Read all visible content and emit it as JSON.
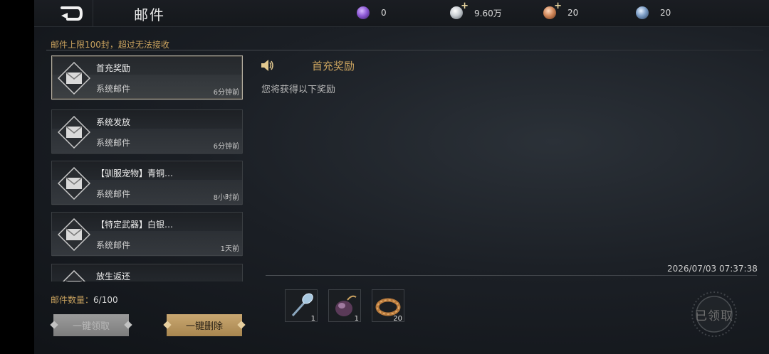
{
  "header": {
    "title": "邮件",
    "back_icon": "back-arrow-icon",
    "currencies": [
      {
        "name": "purple-gem",
        "value": "0",
        "color": "#8e5ad6",
        "has_plus": false
      },
      {
        "name": "silver-coin",
        "value": "9.60万",
        "color": "#c8cdd2",
        "has_plus": true
      },
      {
        "name": "copper-coin",
        "value": "20",
        "color": "#d0875a",
        "has_plus": true
      },
      {
        "name": "blue-orb",
        "value": "20",
        "color": "#7a9bc4",
        "has_plus": false
      }
    ]
  },
  "mailbox": {
    "limit_note": "邮件上限100封，超过无法接收",
    "count_label": "邮件数量：",
    "count_value": "6/100",
    "items": [
      {
        "subject": "首充奖励",
        "sender": "系统邮件",
        "time": "6分钟前",
        "active": true
      },
      {
        "subject": "系统发放",
        "sender": "系统邮件",
        "time": "6分钟前",
        "active": false
      },
      {
        "subject": "【驯服宠物】青铜…",
        "sender": "系统邮件",
        "time": "8小时前",
        "active": false
      },
      {
        "subject": "【特定武器】白银…",
        "sender": "系统邮件",
        "time": "1天前",
        "active": false
      },
      {
        "subject": "放生返还",
        "sender": "",
        "time": "",
        "active": false
      }
    ],
    "claim_all_label": "一键领取",
    "delete_all_label": "一键删除"
  },
  "detail": {
    "title": "首充奖励",
    "body": "您将获得以下奖励",
    "date": "2026/07/03 07:37:38",
    "attachments": [
      {
        "icon": "hammer-staff-icon",
        "qty": "1"
      },
      {
        "icon": "pouch-icon",
        "qty": "1"
      },
      {
        "icon": "bronze-ring-icon",
        "qty": "20"
      }
    ],
    "claimed_label": "已领取"
  }
}
